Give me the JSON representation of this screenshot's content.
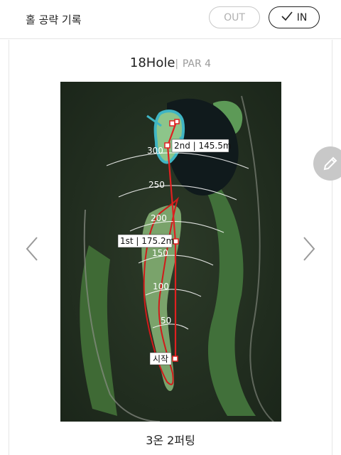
{
  "header": {
    "title": "홀 공략 기록",
    "out_label": "OUT",
    "in_label": "IN",
    "check_icon": "check-icon"
  },
  "hole": {
    "name": "18Hole",
    "separator": "|",
    "par": "PAR 4"
  },
  "distance_markers": [
    "300",
    "250",
    "200",
    "150",
    "100",
    "50"
  ],
  "shots": {
    "start_label": "시작",
    "first_label": "1st | 175.2m",
    "second_label": "2nd | 145.5m"
  },
  "result": "3온 2퍼팅",
  "colors": {
    "shot_line": "#e02020",
    "green_highlight": "#3fb5c4",
    "fairway_outline": "#d11a1a"
  },
  "icons": {
    "prev": "chevron-left-icon",
    "next": "chevron-right-icon",
    "edit": "pencil-icon"
  }
}
